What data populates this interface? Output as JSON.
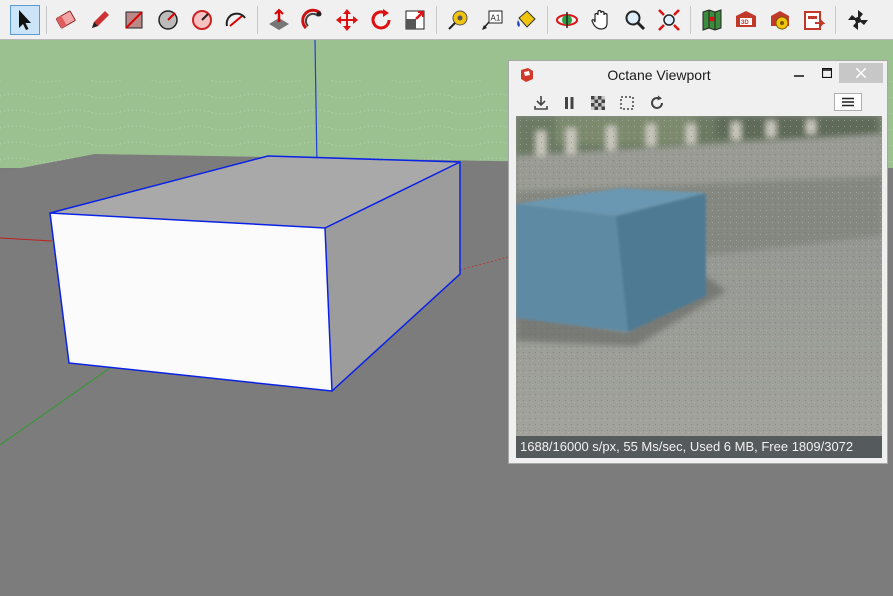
{
  "toolbar": {
    "tools": [
      {
        "icon": "select-arrow-icon",
        "active": true
      },
      {
        "icon": "eraser-icon"
      },
      {
        "icon": "pencil-icon"
      },
      {
        "icon": "rectangle-icon"
      },
      {
        "icon": "circle-icon"
      },
      {
        "icon": "polygon-icon"
      },
      {
        "icon": "arc-icon"
      },
      {
        "icon": "push-pull-icon"
      },
      {
        "icon": "follow-me-icon"
      },
      {
        "icon": "move-icon"
      },
      {
        "icon": "rotate-icon"
      },
      {
        "icon": "scale-icon"
      },
      {
        "icon": "tape-measure-icon"
      },
      {
        "icon": "text-label-icon"
      },
      {
        "icon": "paint-bucket-icon"
      },
      {
        "icon": "orbit-icon"
      },
      {
        "icon": "pan-hand-icon"
      },
      {
        "icon": "zoom-icon"
      },
      {
        "icon": "zoom-extents-icon"
      },
      {
        "icon": "map-location-icon"
      },
      {
        "icon": "warehouse-3d-icon"
      },
      {
        "icon": "extension-warehouse-icon"
      },
      {
        "icon": "layout-send-icon"
      },
      {
        "icon": "octane-render-icon"
      }
    ]
  },
  "octane_window": {
    "title": "Octane Viewport",
    "status": "1688/16000 s/px, 55 Ms/sec, Used 6 MB, Free 1809/3072",
    "tools": [
      "download-icon",
      "pause-icon",
      "checker-icon",
      "region-select-icon",
      "restart-icon"
    ],
    "menu_icon": "hamburger-menu-icon"
  },
  "colors": {
    "ground": "#7c7c7c",
    "sky": "#9cc191",
    "box_front": "#fbfbfb",
    "box_side": "#9c9c9c",
    "box_top": "#a8a8a8",
    "edge": "#0a22e6",
    "render_box": "#5f8aa4"
  }
}
